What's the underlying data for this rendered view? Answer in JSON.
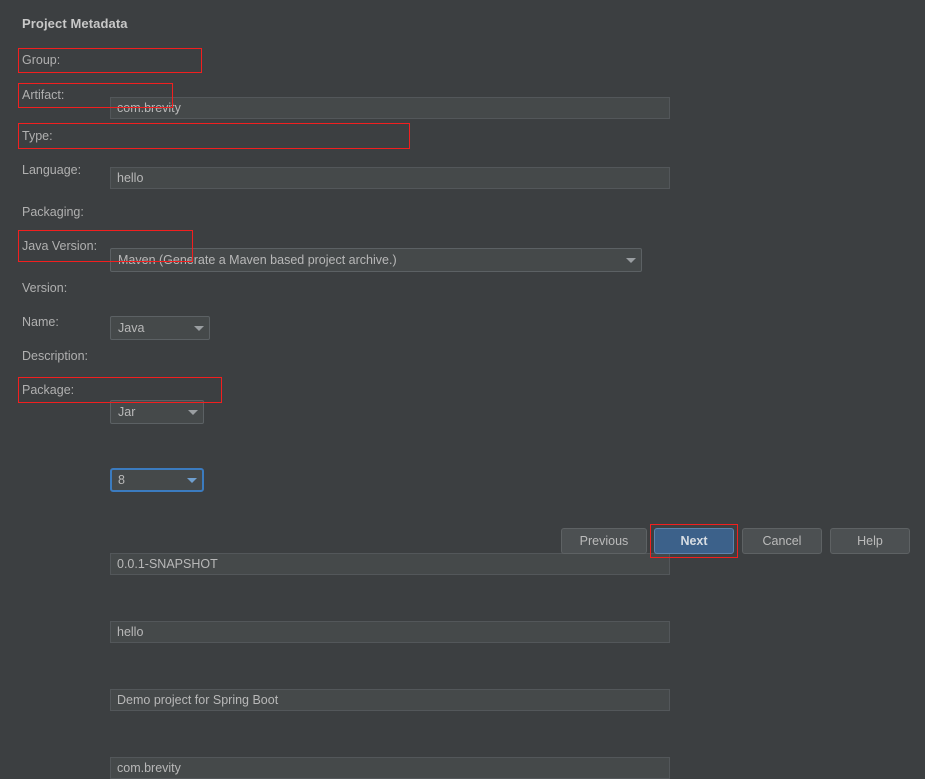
{
  "window": {
    "title": "Project Metadata",
    "background_color": "#3c3f41",
    "field_color": "#45494a",
    "accent_color": "#3c618a",
    "annotation_color": "#f21f1f",
    "focus_ring_color": "#3b7bbf"
  },
  "form": {
    "fields": [
      {
        "label": "Group:",
        "value": "com.brevity",
        "type": "text",
        "annotated": true
      },
      {
        "label": "Artifact:",
        "value": "hello",
        "type": "text",
        "annotated": true
      },
      {
        "label": "Type:",
        "value": "Maven (Generate a Maven based project archive.)",
        "type": "combo",
        "annotated": true
      },
      {
        "label": "Language:",
        "value": "Java",
        "type": "combo",
        "annotated": false
      },
      {
        "label": "Packaging:",
        "value": "Jar",
        "type": "combo",
        "annotated": false
      },
      {
        "label": "Java Version:",
        "value": "8",
        "type": "combo",
        "annotated": true,
        "focused": true
      },
      {
        "label": "Version:",
        "value": "0.0.1-SNAPSHOT",
        "type": "text",
        "annotated": false
      },
      {
        "label": "Name:",
        "value": "hello",
        "type": "text",
        "annotated": false
      },
      {
        "label": "Description:",
        "value": "Demo project for Spring Boot",
        "type": "text",
        "annotated": false
      },
      {
        "label": "Package:",
        "value": "com.brevity",
        "type": "text",
        "annotated": true
      }
    ]
  },
  "buttons": [
    {
      "label": "Previous",
      "primary": false,
      "annotated": false
    },
    {
      "label": "Next",
      "primary": true,
      "annotated": true
    },
    {
      "label": "Cancel",
      "primary": false,
      "annotated": false
    },
    {
      "label": "Help",
      "primary": false,
      "annotated": false
    }
  ]
}
